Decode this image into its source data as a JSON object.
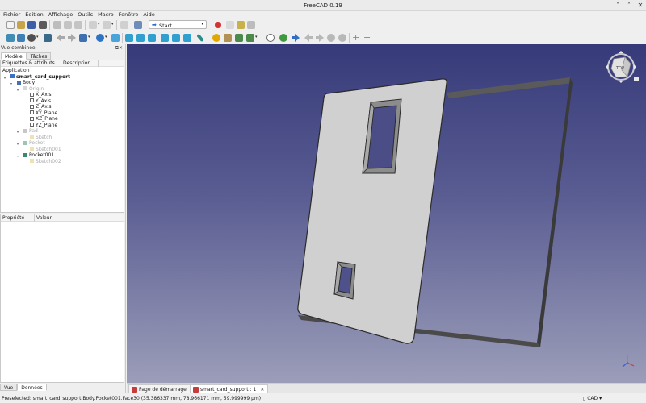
{
  "window": {
    "title": "FreeCAD 0.19",
    "minimize": "˅",
    "maximize": "˄",
    "close": "✕"
  },
  "menu": [
    "Fichier",
    "Édition",
    "Affichage",
    "Outils",
    "Macro",
    "Fenêtre",
    "Aide"
  ],
  "toolbar": {
    "workbench": "Start"
  },
  "combo_view": {
    "title": "Vue combinée",
    "tabs": [
      "Modèle",
      "Tâches"
    ],
    "tree_headers": [
      "Étiquettes & attributs",
      "Description"
    ],
    "tree": [
      {
        "label": "Application",
        "depth": 0,
        "state": "normal",
        "icon": "none",
        "twisty": ""
      },
      {
        "label": "smart_card_support",
        "depth": 1,
        "state": "bold",
        "icon": "document-icon",
        "twisty": "▾"
      },
      {
        "label": "Body",
        "depth": 2,
        "state": "normal",
        "icon": "body-icon",
        "twisty": "▾"
      },
      {
        "label": "Origin",
        "depth": 3,
        "state": "gray",
        "icon": "origin-icon",
        "twisty": "▾"
      },
      {
        "label": "X_Axis",
        "depth": 4,
        "state": "normal",
        "icon": "axis-icon",
        "twisty": ""
      },
      {
        "label": "Y_Axis",
        "depth": 4,
        "state": "normal",
        "icon": "axis-icon",
        "twisty": ""
      },
      {
        "label": "Z_Axis",
        "depth": 4,
        "state": "normal",
        "icon": "axis-icon",
        "twisty": ""
      },
      {
        "label": "XY_Plane",
        "depth": 4,
        "state": "normal",
        "icon": "plane-icon",
        "twisty": ""
      },
      {
        "label": "XZ_Plane",
        "depth": 4,
        "state": "normal",
        "icon": "plane-icon",
        "twisty": ""
      },
      {
        "label": "YZ_Plane",
        "depth": 4,
        "state": "normal",
        "icon": "plane-icon",
        "twisty": ""
      },
      {
        "label": "Pad",
        "depth": 3,
        "state": "gray",
        "icon": "pad-icon",
        "twisty": "▾"
      },
      {
        "label": "Sketch",
        "depth": 4,
        "state": "gray",
        "icon": "sketch-icon",
        "twisty": ""
      },
      {
        "label": "Pocket",
        "depth": 3,
        "state": "gray",
        "icon": "pocket-icon",
        "twisty": "▾"
      },
      {
        "label": "Sketch001",
        "depth": 4,
        "state": "gray",
        "icon": "sketch-icon",
        "twisty": ""
      },
      {
        "label": "Pocket001",
        "depth": 3,
        "state": "normal",
        "icon": "pocket-icon",
        "twisty": "▾"
      },
      {
        "label": "Sketch002",
        "depth": 4,
        "state": "gray",
        "icon": "sketch-icon",
        "twisty": ""
      }
    ],
    "property_headers": [
      "Propriété",
      "Valeur"
    ],
    "bottom_tabs": [
      "Vue",
      "Données"
    ]
  },
  "navcube": {
    "face": "TOP"
  },
  "document_tabs": [
    {
      "label": "Page de démarrage",
      "close": "✕"
    },
    {
      "label": "smart_card_support : 1",
      "close": "✕"
    }
  ],
  "statusbar": {
    "message": "Preselected: smart_card_support.Body.Pocket001.Face30 (35.386337 mm, 78.966171 mm, 59.999999 µm)",
    "nav_style": "CAD"
  },
  "colors": {
    "viewport_top": "#363a79",
    "viewport_bottom": "#9b9db9",
    "part_face": "#cfcfcf",
    "selection": "#4a88d9"
  }
}
